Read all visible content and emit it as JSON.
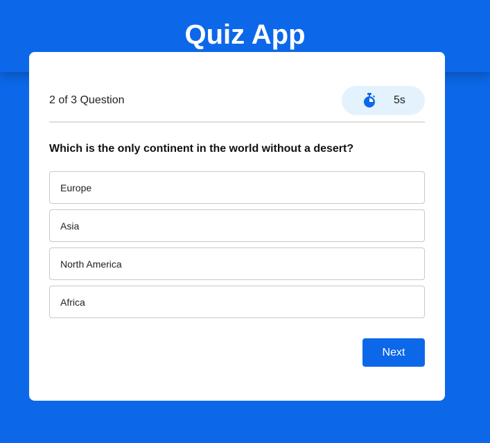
{
  "app": {
    "title": "Quiz App"
  },
  "quiz": {
    "progress": "2 of 3 Question",
    "timer": "5s",
    "question": "Which is the only continent in the world without a desert?",
    "options": [
      "Europe",
      "Asia",
      "North America",
      "Africa"
    ],
    "next_label": "Next"
  },
  "colors": {
    "brand": "#0c68e9",
    "card": "#ffffff",
    "timer_background": "#e4f2fd",
    "timer_icon": "#0c68e9"
  },
  "icons": {
    "timer": "stopwatch-icon"
  }
}
